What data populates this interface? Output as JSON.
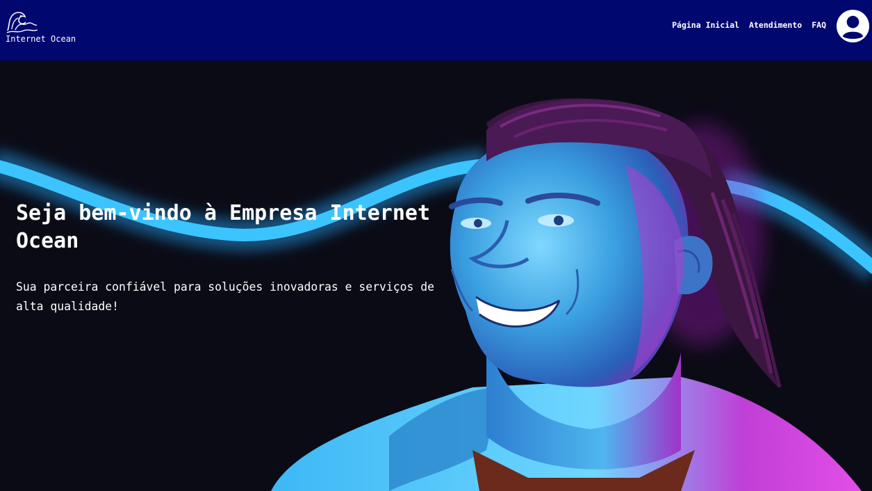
{
  "brand": {
    "name": "Internet Ocean",
    "logo_icon": "wave-icon"
  },
  "nav": {
    "items": [
      {
        "label": "Página Inicial"
      },
      {
        "label": "Atendimento"
      },
      {
        "label": "FAQ"
      }
    ],
    "account_icon": "user-account-icon"
  },
  "hero": {
    "title": "Seja bem-vindo à Empresa Internet Ocean",
    "subtitle": "Sua parceira confiável para soluções inovadoras e serviços de alta qualidade!",
    "image": "smiling-man-neon-light-photo"
  },
  "colors": {
    "navbar": "#00076f",
    "hero_background": "#0b0b16",
    "neon_blue": "#29b6f6",
    "neon_magenta": "#d62bd9",
    "text": "#ffffff"
  }
}
